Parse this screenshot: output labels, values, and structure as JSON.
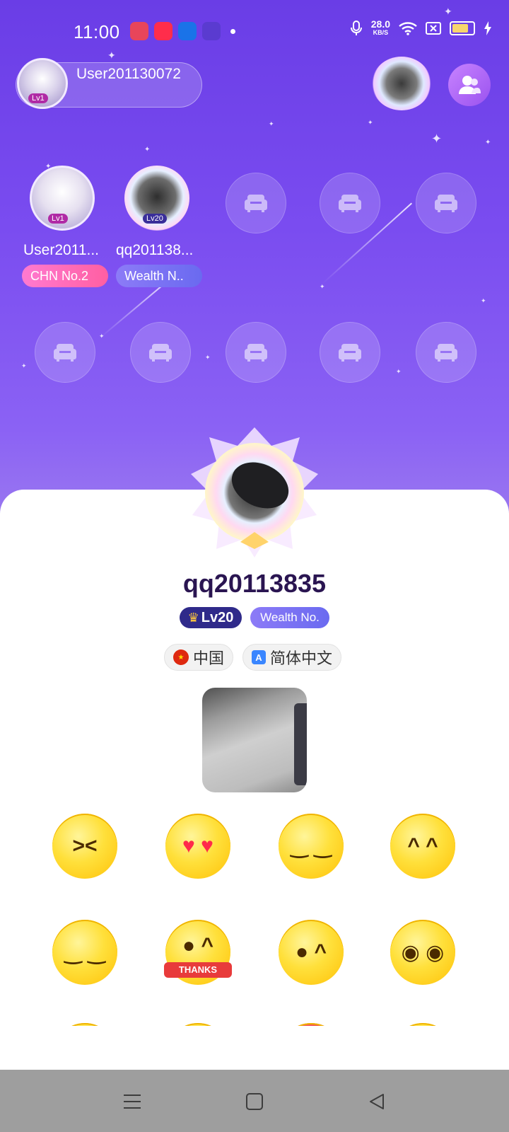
{
  "status_bar": {
    "time": "11:00",
    "net_speed": "28.0",
    "net_unit": "KB/S",
    "icons": [
      "baidu-app-icon",
      "youtube-app-icon",
      "app-icon",
      "app-icon",
      "mic-icon",
      "wifi-icon",
      "sim-off-icon",
      "battery-icon",
      "charging-icon"
    ]
  },
  "host": {
    "name": "User201130072",
    "level": "Lv1"
  },
  "seats_row1": [
    {
      "name": "User2011...",
      "tag": "CHN No.2",
      "occupied": true
    },
    {
      "name": "qq201138...",
      "tag": "Wealth N..",
      "occupied": true
    },
    {
      "name": "",
      "tag": "",
      "occupied": false
    },
    {
      "name": "",
      "tag": "",
      "occupied": false
    },
    {
      "name": "",
      "tag": "",
      "occupied": false
    }
  ],
  "profile": {
    "name": "qq20113835",
    "level": "Lv20",
    "wealth": "Wealth No.",
    "country": "中国",
    "language": "简体中文"
  },
  "emojis": [
    "laughing",
    "heart-eyes",
    "praying",
    "tears-of-joy",
    "cheers",
    "thanks",
    "wink-heart",
    "smile",
    "sunglasses",
    "crying",
    "angry",
    "wink"
  ],
  "emoji_thanks_label": "THANKS",
  "colors": {
    "bg_top": "#6a3de6",
    "accent_pink": "#ff6fb0",
    "accent_purple": "#8c7bf7",
    "navbar": "#9e9e9e"
  }
}
